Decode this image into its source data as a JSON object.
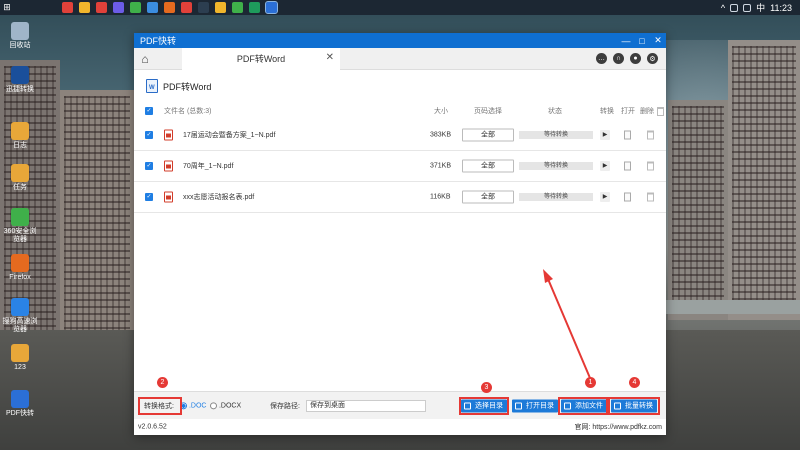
{
  "taskbar": {
    "clock": "11:23",
    "ime": "中",
    "caret": "^"
  },
  "desktop": {
    "icons": [
      {
        "label": "回收站",
        "color": "#9fb5c9"
      },
      {
        "label": "迅捷转换",
        "color": "#1a4f9b"
      },
      {
        "label": "日志",
        "color": "#e8a739"
      },
      {
        "label": "任务",
        "color": "#e8a739"
      },
      {
        "label": "360安全浏览器",
        "color": "#3fb04a"
      },
      {
        "label": "Firefox",
        "color": "#e56a1f"
      },
      {
        "label": "搜狗高速浏览器",
        "color": "#2a83e6"
      },
      {
        "label": "123",
        "color": "#e8a739"
      },
      {
        "label": "PDF快转",
        "color": "#2b6fd6"
      }
    ]
  },
  "window": {
    "title": "PDF快转",
    "controls": {
      "min": "—",
      "max": "□",
      "close": "✕"
    }
  },
  "tabs": {
    "active_label": "PDF转Word",
    "close": "✕"
  },
  "subheader": {
    "title": "PDF转Word",
    "icon": "word-icon"
  },
  "table": {
    "header": {
      "filename": "文件名 (总数:3)",
      "size": "大小",
      "pages": "页码选择",
      "status": "状态",
      "convert": "转换",
      "open": "打开",
      "delete": "删除"
    },
    "rows": [
      {
        "name": "17届运动会暨备方案_1~N.pdf",
        "size": "383KB",
        "pages": "全部",
        "status": "等待转换"
      },
      {
        "name": "70周年_1~N.pdf",
        "size": "371KB",
        "pages": "全部",
        "status": "等待转换"
      },
      {
        "name": "xxx志愿活动报名表.pdf",
        "size": "116KB",
        "pages": "全部",
        "status": "等待转换"
      }
    ]
  },
  "bottom": {
    "format_label": "转换格式:",
    "format_options": [
      ".DOC",
      ".DOCX"
    ],
    "save_path_label": "保存路径:",
    "save_path_value": "保存到桌面",
    "buttons": {
      "choose_dir": "选择目录",
      "open_dir": "打开目录",
      "add_file": "添加文件",
      "batch_convert": "批量转换"
    },
    "badges": [
      "1",
      "2",
      "3",
      "4"
    ]
  },
  "status_line": {
    "version": "v2.0.6.52",
    "website": "官网: https://www.pdfkz.com"
  },
  "colors": {
    "brand": "#0f6fd1",
    "button": "#1d7ad8",
    "highlight": "#e53935"
  }
}
